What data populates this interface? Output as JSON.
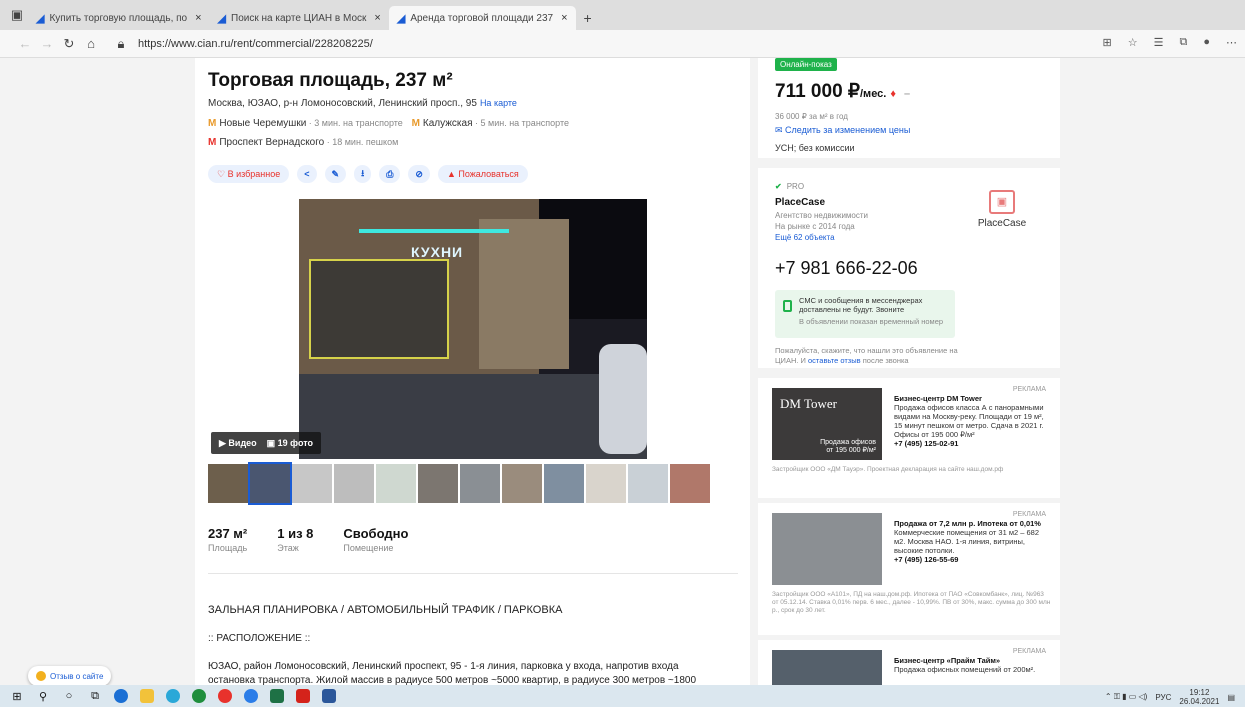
{
  "browser": {
    "tabs": [
      {
        "label": "Купить торговую площадь, по",
        "active": false
      },
      {
        "label": "Поиск на карте ЦИАН в Моск",
        "active": false
      },
      {
        "label": "Аренда торговой площади 237",
        "active": true
      }
    ],
    "new_tab": "+",
    "url": "https://www.cian.ru/rent/commercial/228208225/",
    "close_icon": "×"
  },
  "listing": {
    "title": "Торговая площадь, 237 м²",
    "address": "Москва, ЮЗАО, р-н Ломоносовский, Ленинский просп., 95",
    "map_link": "На карте",
    "metro": [
      {
        "name": "Новые Черемушки",
        "time": " · 3 мин. на транспорте",
        "color": "#e89a2c"
      },
      {
        "name": "Калужская",
        "time": " · 5 мин. на транспорте",
        "color": "#e89a2c"
      },
      {
        "name": "Проспект Вернадского",
        "time": " · 18 мин. пешком",
        "color": "#e8322c"
      }
    ],
    "actions": {
      "favorite": "♡ В избранное",
      "share": "<",
      "edit": "✎",
      "download": "⭳",
      "print": "⎙",
      "hide": "⊘",
      "report": "▲ Пожаловаться"
    },
    "photo": {
      "sign": "КУХНИ",
      "video": "▶ Видео",
      "photos": "▣ 19 фото"
    },
    "thumb_colors": [
      "#6d5f4c",
      "#4a5670",
      "#c7c7c7",
      "#bdbdbd",
      "#cfd8d0",
      "#7c7670",
      "#8a8f94",
      "#9a8c7d",
      "#7f8fa0",
      "#d9d4cc",
      "#c9d0d6",
      "#b0786a"
    ],
    "stats": [
      {
        "value": "237 м²",
        "label": "Площадь"
      },
      {
        "value": "1 из 8",
        "label": "Этаж"
      },
      {
        "value": "Свободно",
        "label": "Помещение"
      }
    ],
    "desc_heading": "ЗАЛЬНАЯ ПЛАНИРОВКА / АВТОМОБИЛЬНЫЙ ТРАФИК / ПАРКОВКА",
    "desc_section": ":: РАСПОЛОЖЕНИЕ ::",
    "desc_text": "ЮЗАО, район Ломоносовский, Ленинский проспект, 95 - 1-я линия, парковка у входа, напротив входа остановка транспорта. Жилой массив в радиусе 500 метров ~5000 квартир, в радиусе 300 метров ~1800",
    "feedback": "Отзыв о сайте"
  },
  "price_card": {
    "online": "Онлайн-показ",
    "price": "711 000 ₽",
    "per": "/мес.",
    "arrow": "♦",
    "dash": "–",
    "per_m2": "36 000 ₽ за м² в год",
    "follow": "✉ Следить за изменением цены",
    "tax": "УСН; без комиссии"
  },
  "agent": {
    "pro": "PRO",
    "pro_check": "✔",
    "name": "PlaceCase",
    "type": "Агентство недвижимости",
    "since": "На рынке с 2014 года",
    "objects": "Ещё 62 объекта",
    "logo_text": "PlaceCase",
    "logo_mark": "▣",
    "phone": "+7 981 666-22-06",
    "sms_text": "СМС и сообщения в мессенджерах доставлены не будут. Звоните",
    "sms_note": "В объявлении показан временный номер",
    "ask": "Пожалуйста, скажите, что нашли это объявление на ЦИАН. И ",
    "ask_link": "оставьте отзыв",
    "ask_end": " после звонка"
  },
  "ads": [
    {
      "label": "РЕКЛАМА",
      "title": "Бизнес-центр DM Tower",
      "text": "Продажа офисов класса А с панорамными видами на Москву-реку. Площади от 19 м², 15 минут пешком от метро. Сдача в 2021 г. Офисы от 195 000 ₽/м²",
      "phone": "+7 (495) 125-02-91",
      "footer": "Застройщик ООО «ДМ Тауэр». Проектная декларация на сайте наш.дом.рф",
      "img_text": "DM Tower",
      "img_sub": "Продажа офисов от 195 000 ₽/м²"
    },
    {
      "label": "РЕКЛАМА",
      "title": "Продажа от 7,2 млн р. Ипотека от 0,01%",
      "text": "Коммерческие помещения от 31 м2 – 682 м2. Москва НАО. 1-я линия, витрины, высокие потолки.",
      "phone": "+7 (495) 126-55-69",
      "footer": "Застройщик ООО «А101», ПД на наш.дом.рф. Ипотека от ПАО «Совкомбанк», лиц. №963 от 05.12.14. Ставка 0,01% перв. 6 мес., далее - 10,99%. ПВ от 30%, макс. сумма до 300 млн р., срок до 30 лет.",
      "img_text": "",
      "img_sub": ""
    },
    {
      "label": "РЕКЛАМА",
      "title": "Бизнес-центр «Прайм Тайм»",
      "text": "Продажа офисных помещений от 200м².",
      "phone": "",
      "footer": "",
      "img_text": "",
      "img_sub": ""
    }
  ],
  "taskbar": {
    "lang": "РУС",
    "time": "19:12",
    "date": "26.04.2021"
  }
}
